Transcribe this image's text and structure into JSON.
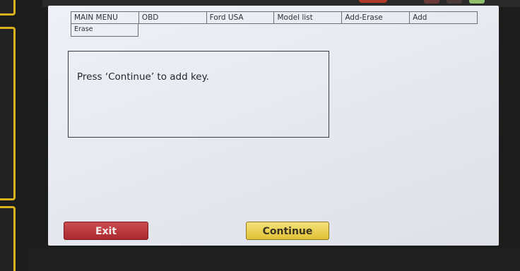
{
  "breadcrumb": {
    "items": [
      "MAIN MENU",
      "OBD",
      "Ford USA",
      "Model list",
      "Add-Erase",
      "Add"
    ],
    "overflow": "Erase"
  },
  "dialog": {
    "message": "Press ‘Continue’ to add key."
  },
  "buttons": {
    "exit_label": "Exit",
    "continue_label": "Continue"
  },
  "colors": {
    "exit_button": "#b9353a",
    "continue_button": "#ebd257",
    "screen_background": "#e8eaf0",
    "device_frame": "#1c1c1c",
    "side_button_border": "#d8b21d"
  }
}
